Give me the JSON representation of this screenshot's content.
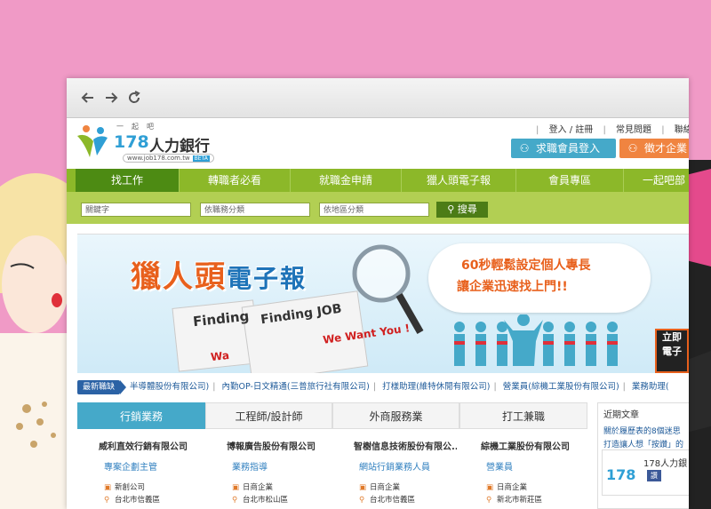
{
  "site": {
    "logo_tag": "一起吧",
    "logo_number": "178",
    "logo_name": "人力銀行",
    "logo_url": "www.job178.com.tw",
    "logo_beta": "BETA"
  },
  "toplinks": [
    "登入 / 註冊",
    "常見問題",
    "聯絡"
  ],
  "buttons": {
    "login": "求職會員登入",
    "employer": "徵才企業"
  },
  "nav": {
    "tabs": [
      "找工作",
      "轉職者必看",
      "就職金申請",
      "獵人頭電子報",
      "會員專區",
      "一起吧部"
    ]
  },
  "search": {
    "keyword_placeholder": "關鍵字",
    "category_placeholder": "依職務分類",
    "area_placeholder": "依地區分類",
    "button": "搜尋"
  },
  "banner": {
    "title_a": "獵人頭",
    "title_b": "電子報",
    "line1": "60秒輕鬆設定個人專長",
    "line2": "讓企業迅速找上門!!",
    "finding1": "Finding",
    "finding2": "Finding JOB",
    "want_you": "We Want You !",
    "want_short": "Wa",
    "corner": "立即 電子"
  },
  "ticker": {
    "badge": "最新職缺",
    "items": [
      "半導體股份有限公司)",
      "內勤OP-日文精通(三普旅行社有限公司)",
      "打樣助理(維特休閒有限公司)",
      "營業員(綜機工業股份有限公司)",
      "業務助理("
    ]
  },
  "job_tabs": [
    "行銷業務",
    "工程師/設計師",
    "外商服務業",
    "打工兼職"
  ],
  "jobs": [
    {
      "company": "威利直效行銷有限公司",
      "position": "專案企劃主管",
      "salary": "新創公司",
      "area": "台北市信義區"
    },
    {
      "company": "博報廣告股份有限公司",
      "position": "業務指導",
      "salary": "日商企業",
      "area": "台北市松山區"
    },
    {
      "company": "智樹信息技術股份有限公...",
      "position": "網站行銷業務人員",
      "salary": "日商企業",
      "area": "台北市信義區"
    },
    {
      "company": "綜機工業股份有限公司",
      "position": "營業員",
      "salary": "日商企業",
      "area": "新北市新莊區"
    }
  ],
  "sidebar": {
    "heading": "近期文章",
    "links": [
      "關於履歷表的8個迷思",
      "打造讓人想「按讚」的"
    ],
    "fb_number": "178",
    "fb_name": "178人力銀",
    "fb_like": "讚"
  },
  "colors": {
    "background": "#f09ac6",
    "nav_green": "#8cb829",
    "nav_active": "#4d8b13",
    "login_blue": "#45a9c9",
    "employer_orange": "#f08440",
    "brand_blue": "#2f9fd5"
  }
}
